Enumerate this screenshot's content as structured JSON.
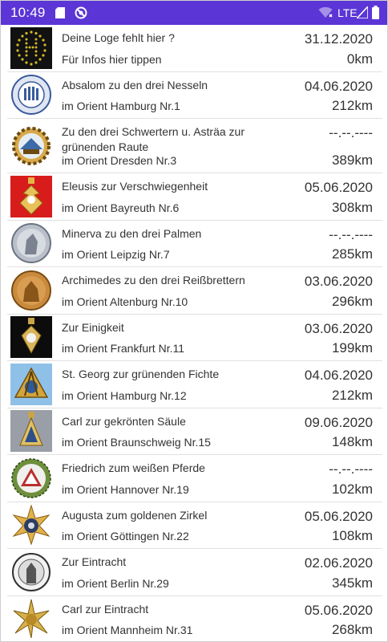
{
  "status_bar": {
    "time": "10:49",
    "network": "LTE",
    "icons": [
      "sim-card-icon",
      "do-not-disturb-icon",
      "wifi-off-icon",
      "signal-icon",
      "battery-icon"
    ],
    "background_color": "#5b35d6"
  },
  "lodges": [
    {
      "name": "Deine Loge fehlt hier ?",
      "orient": "Für Infos hier tippen",
      "date": "31.12.2020",
      "distance": "0km",
      "icon": "lodge-placeholder-icon"
    },
    {
      "name": "Absalom zu den drei Nesseln",
      "orient": "im Orient Hamburg Nr.1",
      "date": "04.06.2020",
      "distance": "212km",
      "icon": "lodge-seal-icon"
    },
    {
      "name": "Zu den drei Schwertern u. Asträa zur grünenden Raute",
      "orient": "im Orient Dresden Nr.3",
      "date": "--.--.----",
      "distance": "389km",
      "icon": "lodge-gear-emblem-icon"
    },
    {
      "name": "Eleusis zur Verschwiegenheit",
      "orient": "im Orient Bayreuth Nr.6",
      "date": "05.06.2020",
      "distance": "308km",
      "icon": "lodge-jewel-red-icon"
    },
    {
      "name": "Minerva zu den drei Palmen",
      "orient": "im Orient Leipzig Nr.7",
      "date": "--.--.----",
      "distance": "285km",
      "icon": "lodge-medal-silver-icon"
    },
    {
      "name": "Archimedes zu den drei Reißbrettern",
      "orient": "im Orient Altenburg Nr.10",
      "date": "03.06.2020",
      "distance": "296km",
      "icon": "lodge-medal-bronze-icon"
    },
    {
      "name": "Zur Einigkeit",
      "orient": "im Orient Frankfurt Nr.11",
      "date": "03.06.2020",
      "distance": "199km",
      "icon": "lodge-jewel-black-icon"
    },
    {
      "name": "St. Georg zur grünenden Fichte",
      "orient": "im Orient Hamburg Nr.12",
      "date": "04.06.2020",
      "distance": "212km",
      "icon": "lodge-compass-blue-icon"
    },
    {
      "name": "Carl zur gekrönten Säule",
      "orient": "im Orient Braunschweig Nr.15",
      "date": "09.06.2020",
      "distance": "148km",
      "icon": "lodge-jewel-grey-icon"
    },
    {
      "name": "Friedrich zum weißen Pferde",
      "orient": "im Orient Hannover Nr.19",
      "date": "--.--.----",
      "distance": "102km",
      "icon": "lodge-triangle-emblem-icon"
    },
    {
      "name": "Augusta zum goldenen Zirkel",
      "orient": "im Orient Göttingen Nr.22",
      "date": "05.06.2020",
      "distance": "108km",
      "icon": "lodge-star-icon"
    },
    {
      "name": "Zur Eintracht",
      "orient": "im Orient Berlin Nr.29",
      "date": "02.06.2020",
      "distance": "345km",
      "icon": "lodge-seal-bw-icon"
    },
    {
      "name": "Carl zur Eintracht",
      "orient": "im Orient Mannheim Nr.31",
      "date": "05.06.2020",
      "distance": "268km",
      "icon": "lodge-star-gold-icon"
    }
  ]
}
